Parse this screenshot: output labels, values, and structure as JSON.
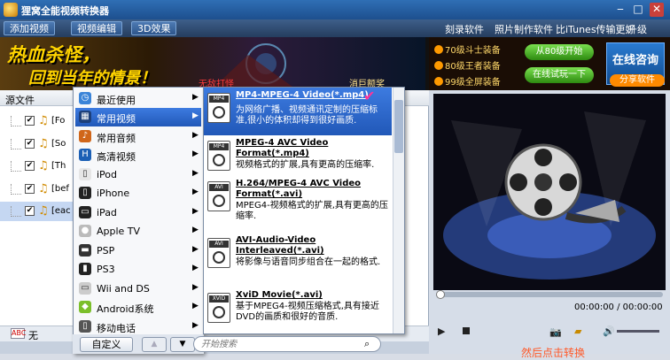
{
  "app": {
    "title": "狸窝全能视频转换器"
  },
  "toolbar": {
    "tabs": [
      "添加视频",
      "视频编辑",
      "3D效果"
    ],
    "links": [
      "刻录软件",
      "照片制作软件",
      "比iTunes传输更好",
      "升级"
    ]
  },
  "banner": {
    "slogan1": "热血杀怪，",
    "slogan2": "回到当年的情景！",
    "tag1": "无敌打怪",
    "tag2": "消巨额奖",
    "ads": [
      "70级斗士装备",
      "80级王者装备",
      "99级全屏装备"
    ],
    "btn1": "从80级开始",
    "btn2": "在线试玩一下",
    "consult": "在线咨询",
    "share": "分享软件"
  },
  "filelist": {
    "header": "源文件",
    "rows": [
      "[Fo",
      "[So",
      "[Th",
      "[bef",
      "[eac"
    ]
  },
  "menu1": {
    "items": [
      {
        "label": "最近使用",
        "icon": "clock-icon"
      },
      {
        "label": "常用视频",
        "icon": "film-icon"
      },
      {
        "label": "常用音频",
        "icon": "music-icon"
      },
      {
        "label": "高清视频",
        "icon": "hd-icon"
      },
      {
        "label": "iPod",
        "icon": "ipod-icon"
      },
      {
        "label": "iPhone",
        "icon": "iphone-icon"
      },
      {
        "label": "iPad",
        "icon": "ipad-icon"
      },
      {
        "label": "Apple TV",
        "icon": "apple-icon"
      },
      {
        "label": "PSP",
        "icon": "psp-icon"
      },
      {
        "label": "PS3",
        "icon": "ps3-icon"
      },
      {
        "label": "Wii and DS",
        "icon": "wii-icon"
      },
      {
        "label": "Android系统",
        "icon": "android-icon"
      },
      {
        "label": "移动电话",
        "icon": "phone-icon"
      }
    ],
    "custom_btn": "自定义"
  },
  "menu2": {
    "formats": [
      {
        "title": "MP4-MPEG-4 Video(*.mp4)",
        "desc": "为网络广播、视频通讯定制的压缩标准,很小的体积却得到很好画质.",
        "badge": "MP4"
      },
      {
        "title": "MPEG-4 AVC Video Format(*.mp4)",
        "desc": "视频格式的扩展,具有更高的压缩率.",
        "badge": "MP4"
      },
      {
        "title": "H.264/MPEG-4 AVC Video Format(*.avi)",
        "desc": "MPEG4-视频格式的扩展,具有更高的压缩率.",
        "badge": "AVI"
      },
      {
        "title": "AVI-Audio-Video Interleaved(*.avi)",
        "desc": "将影像与语音同步组合在一起的格式.",
        "badge": "AVI"
      },
      {
        "title": "XviD Movie(*.avi)",
        "desc": "基于MPEG4-视频压缩格式,具有接近DVD的画质和很好的音质.",
        "badge": "XVID"
      }
    ],
    "search_placeholder": "开始搜索"
  },
  "status": {
    "text": "无"
  },
  "player": {
    "time": "00:00:00 / 00:00:00",
    "overlay": "然后点击转换"
  }
}
